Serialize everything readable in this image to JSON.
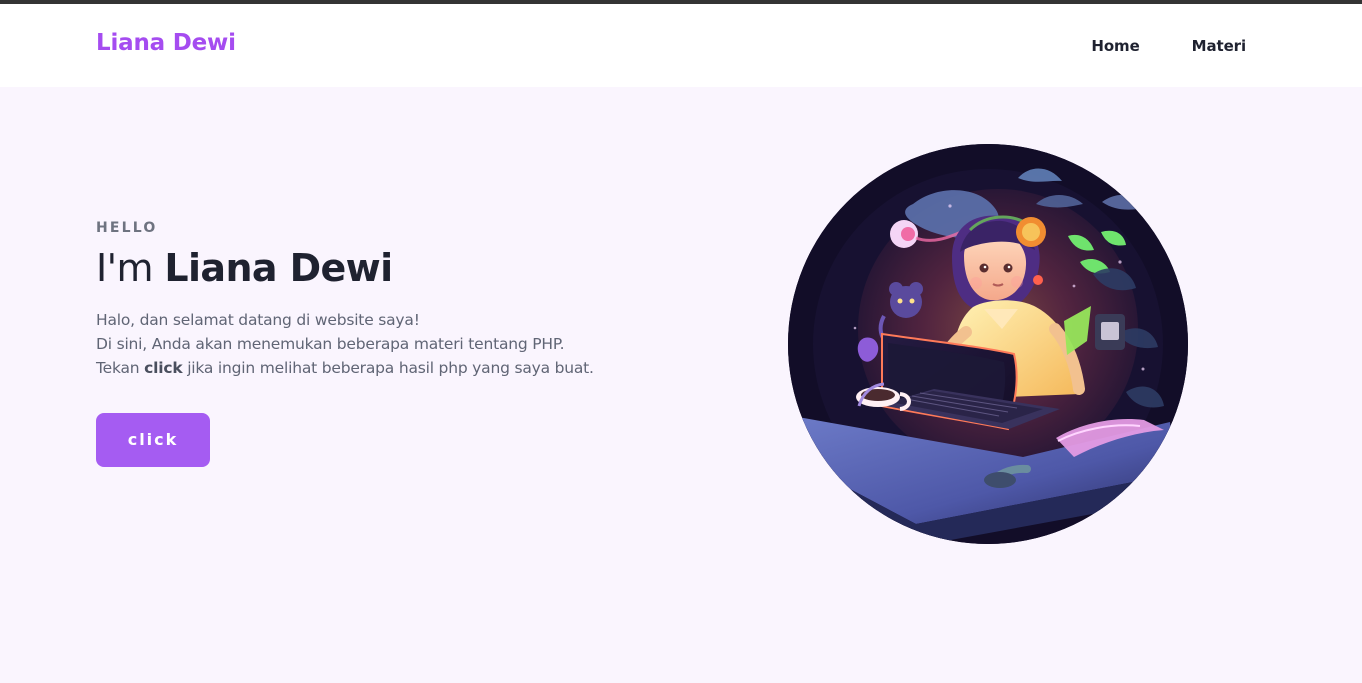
{
  "brand": {
    "name": "Liana Dewi",
    "accent_color": "#a54cf0"
  },
  "nav": {
    "items": [
      "Home",
      "Materi"
    ]
  },
  "hero": {
    "kicker": "HELLO",
    "headline_prefix": "I'm",
    "headline_name": "Liana Dewi",
    "description": {
      "line1": "Halo, dan selamat datang di website saya!",
      "line2": "Di sini, Anda akan menemukan beberapa materi tentang PHP.",
      "line3_prefix": "Tekan",
      "line3_bold": "click",
      "line3_suffix": "jika ingin melihat beberapa hasil php yang saya buat."
    },
    "button_label": "click",
    "button_color": "#a55cf2"
  },
  "illustration": {
    "subject": "person-using-laptop-illustration"
  }
}
